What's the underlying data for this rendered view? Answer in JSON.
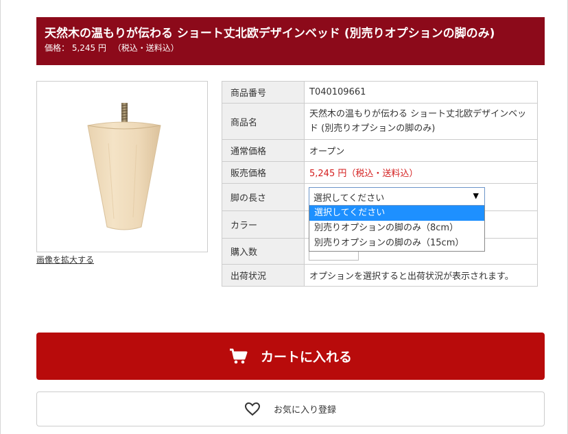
{
  "header": {
    "title": "天然木の温もりが伝わる ショート丈北欧デザインベッド (別売りオプションの脚のみ)",
    "price_line": "価格： 5,245 円 　（税込・送料込）"
  },
  "image": {
    "alt_icon": "wooden-leg-image",
    "zoom_link": "画像を拡大する"
  },
  "spec": {
    "rows": [
      {
        "label": "商品番号",
        "value": "T040109661"
      },
      {
        "label": "商品名",
        "value": "天然木の温もりが伝わる ショート丈北欧デザインベッド (別売りオプションの脚のみ)"
      },
      {
        "label": "通常価格",
        "value": "オープン"
      },
      {
        "label": "販売価格",
        "value": "5,245 円（税込・送料込）"
      },
      {
        "label": "脚の長さ",
        "value": ""
      },
      {
        "label": "カラー",
        "value": ""
      },
      {
        "label": "購入数",
        "value": ""
      },
      {
        "label": "出荷状況",
        "value": "オプションを選択すると出荷状況が表示されます。"
      }
    ]
  },
  "leg_select": {
    "current": "選択してください",
    "arrow": "▼",
    "options": [
      "選択してください",
      "別売りオプションの脚のみ（8cm）",
      "別売りオプションの脚のみ（15cm）"
    ]
  },
  "actions": {
    "cart_label": "カートに入れる",
    "favorite_label": "お気に入り登録"
  },
  "colors": {
    "header_bg": "#8c0a1a",
    "cart_bg": "#b80b0b",
    "price_red": "#d41f1f",
    "selected_option": "#1e90ff"
  }
}
